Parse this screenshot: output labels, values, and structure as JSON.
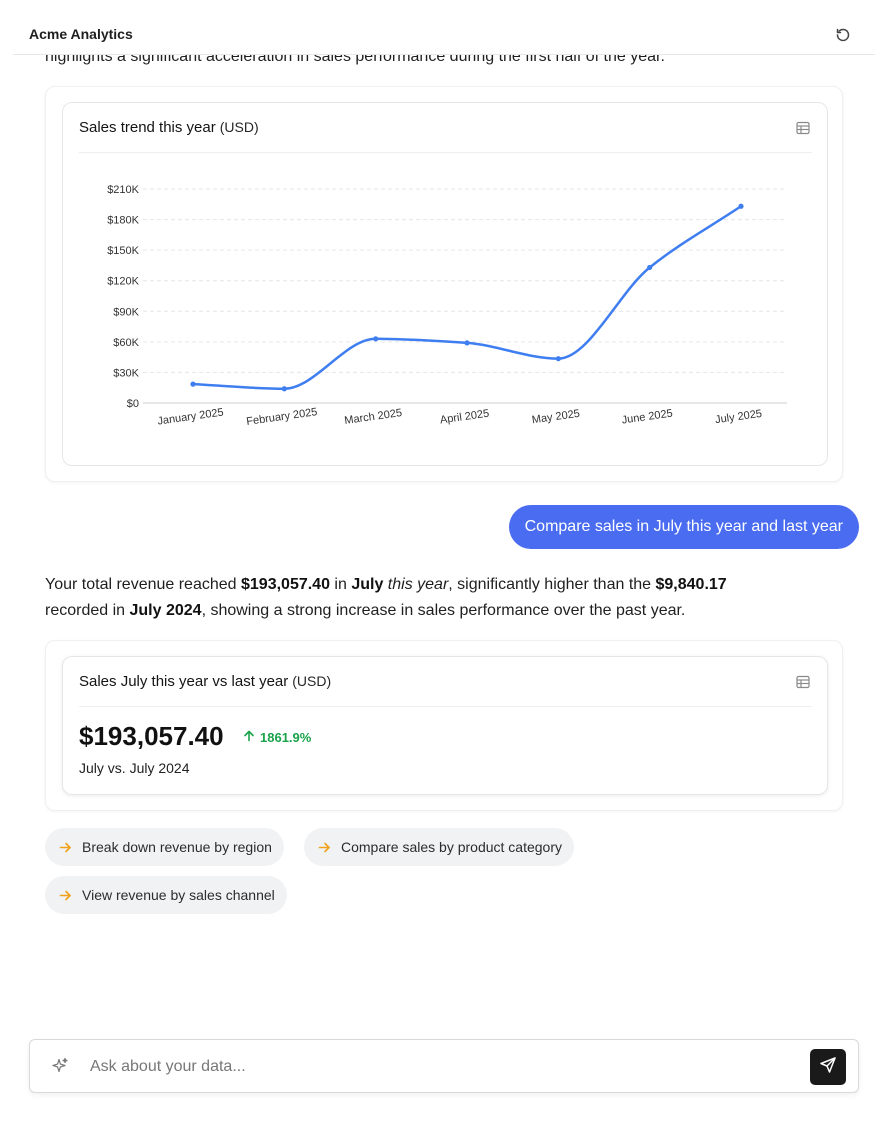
{
  "header": {
    "app_title": "Acme Analytics",
    "refresh_icon": "refresh-icon"
  },
  "previous_message_tail": "highlights a significant acceleration in sales performance during the first half of the year.",
  "trend_card": {
    "title": "Sales trend this year",
    "unit": "(USD)",
    "table_icon": "table-icon"
  },
  "chart_data": {
    "type": "line",
    "title": "Sales trend this year (USD)",
    "categories": [
      "January 2025",
      "February 2025",
      "March 2025",
      "April 2025",
      "May 2025",
      "June 2025",
      "July 2025"
    ],
    "series": [
      {
        "values": [
          18500,
          14000,
          63000,
          59000,
          43500,
          133000,
          193057.4
        ]
      }
    ],
    "ylim": [
      0,
      210000
    ],
    "y_ticks": [
      0,
      30000,
      60000,
      90000,
      120000,
      150000,
      180000,
      210000
    ],
    "y_tick_labels": [
      "$0",
      "$30K",
      "$60K",
      "$90K",
      "$120K",
      "$150K",
      "$180K",
      "$210K"
    ],
    "grid": true,
    "line_color": "#3e7ef0"
  },
  "user_message": "Compare sales in July this year and last year",
  "answer": {
    "p1": "Your total revenue reached ",
    "amount": "$193,057.40",
    "p2": " in ",
    "month": "July",
    "p3": " ",
    "this_year": "this year",
    "p4": ", significantly higher than the ",
    "prev_amount": "$9,840.17",
    "p5": " recorded in ",
    "prev_period": "July 2024",
    "p6": ", showing a strong increase in sales performance over the past year."
  },
  "metric_card": {
    "title": "Sales July this year vs last year",
    "unit": "(USD)",
    "value": "$193,057.40",
    "delta": "1861.9%",
    "delta_color": "#1aa34a",
    "comparison": "July vs. July 2024"
  },
  "suggestions": [
    {
      "label": "Break down revenue by region"
    },
    {
      "label": "Compare sales by product category"
    },
    {
      "label": "View revenue by sales channel"
    }
  ],
  "composer": {
    "placeholder": "Ask about your data...",
    "send_icon": "send-icon"
  }
}
